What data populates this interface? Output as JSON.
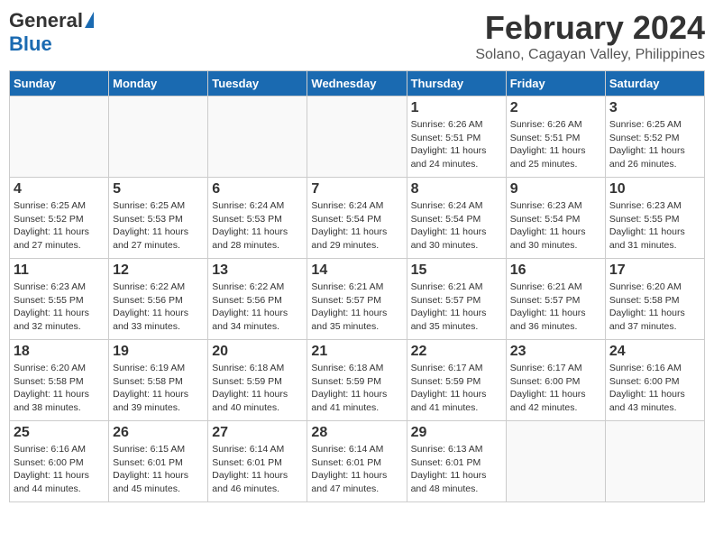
{
  "header": {
    "logo_general": "General",
    "logo_blue": "Blue",
    "title": "February 2024",
    "subtitle": "Solano, Cagayan Valley, Philippines"
  },
  "columns": [
    "Sunday",
    "Monday",
    "Tuesday",
    "Wednesday",
    "Thursday",
    "Friday",
    "Saturday"
  ],
  "weeks": [
    [
      {
        "day": "",
        "info": ""
      },
      {
        "day": "",
        "info": ""
      },
      {
        "day": "",
        "info": ""
      },
      {
        "day": "",
        "info": ""
      },
      {
        "day": "1",
        "info": "Sunrise: 6:26 AM\nSunset: 5:51 PM\nDaylight: 11 hours and 24 minutes."
      },
      {
        "day": "2",
        "info": "Sunrise: 6:26 AM\nSunset: 5:51 PM\nDaylight: 11 hours and 25 minutes."
      },
      {
        "day": "3",
        "info": "Sunrise: 6:25 AM\nSunset: 5:52 PM\nDaylight: 11 hours and 26 minutes."
      }
    ],
    [
      {
        "day": "4",
        "info": "Sunrise: 6:25 AM\nSunset: 5:52 PM\nDaylight: 11 hours and 27 minutes."
      },
      {
        "day": "5",
        "info": "Sunrise: 6:25 AM\nSunset: 5:53 PM\nDaylight: 11 hours and 27 minutes."
      },
      {
        "day": "6",
        "info": "Sunrise: 6:24 AM\nSunset: 5:53 PM\nDaylight: 11 hours and 28 minutes."
      },
      {
        "day": "7",
        "info": "Sunrise: 6:24 AM\nSunset: 5:54 PM\nDaylight: 11 hours and 29 minutes."
      },
      {
        "day": "8",
        "info": "Sunrise: 6:24 AM\nSunset: 5:54 PM\nDaylight: 11 hours and 30 minutes."
      },
      {
        "day": "9",
        "info": "Sunrise: 6:23 AM\nSunset: 5:54 PM\nDaylight: 11 hours and 30 minutes."
      },
      {
        "day": "10",
        "info": "Sunrise: 6:23 AM\nSunset: 5:55 PM\nDaylight: 11 hours and 31 minutes."
      }
    ],
    [
      {
        "day": "11",
        "info": "Sunrise: 6:23 AM\nSunset: 5:55 PM\nDaylight: 11 hours and 32 minutes."
      },
      {
        "day": "12",
        "info": "Sunrise: 6:22 AM\nSunset: 5:56 PM\nDaylight: 11 hours and 33 minutes."
      },
      {
        "day": "13",
        "info": "Sunrise: 6:22 AM\nSunset: 5:56 PM\nDaylight: 11 hours and 34 minutes."
      },
      {
        "day": "14",
        "info": "Sunrise: 6:21 AM\nSunset: 5:57 PM\nDaylight: 11 hours and 35 minutes."
      },
      {
        "day": "15",
        "info": "Sunrise: 6:21 AM\nSunset: 5:57 PM\nDaylight: 11 hours and 35 minutes."
      },
      {
        "day": "16",
        "info": "Sunrise: 6:21 AM\nSunset: 5:57 PM\nDaylight: 11 hours and 36 minutes."
      },
      {
        "day": "17",
        "info": "Sunrise: 6:20 AM\nSunset: 5:58 PM\nDaylight: 11 hours and 37 minutes."
      }
    ],
    [
      {
        "day": "18",
        "info": "Sunrise: 6:20 AM\nSunset: 5:58 PM\nDaylight: 11 hours and 38 minutes."
      },
      {
        "day": "19",
        "info": "Sunrise: 6:19 AM\nSunset: 5:58 PM\nDaylight: 11 hours and 39 minutes."
      },
      {
        "day": "20",
        "info": "Sunrise: 6:18 AM\nSunset: 5:59 PM\nDaylight: 11 hours and 40 minutes."
      },
      {
        "day": "21",
        "info": "Sunrise: 6:18 AM\nSunset: 5:59 PM\nDaylight: 11 hours and 41 minutes."
      },
      {
        "day": "22",
        "info": "Sunrise: 6:17 AM\nSunset: 5:59 PM\nDaylight: 11 hours and 41 minutes."
      },
      {
        "day": "23",
        "info": "Sunrise: 6:17 AM\nSunset: 6:00 PM\nDaylight: 11 hours and 42 minutes."
      },
      {
        "day": "24",
        "info": "Sunrise: 6:16 AM\nSunset: 6:00 PM\nDaylight: 11 hours and 43 minutes."
      }
    ],
    [
      {
        "day": "25",
        "info": "Sunrise: 6:16 AM\nSunset: 6:00 PM\nDaylight: 11 hours and 44 minutes."
      },
      {
        "day": "26",
        "info": "Sunrise: 6:15 AM\nSunset: 6:01 PM\nDaylight: 11 hours and 45 minutes."
      },
      {
        "day": "27",
        "info": "Sunrise: 6:14 AM\nSunset: 6:01 PM\nDaylight: 11 hours and 46 minutes."
      },
      {
        "day": "28",
        "info": "Sunrise: 6:14 AM\nSunset: 6:01 PM\nDaylight: 11 hours and 47 minutes."
      },
      {
        "day": "29",
        "info": "Sunrise: 6:13 AM\nSunset: 6:01 PM\nDaylight: 11 hours and 48 minutes."
      },
      {
        "day": "",
        "info": ""
      },
      {
        "day": "",
        "info": ""
      }
    ]
  ]
}
